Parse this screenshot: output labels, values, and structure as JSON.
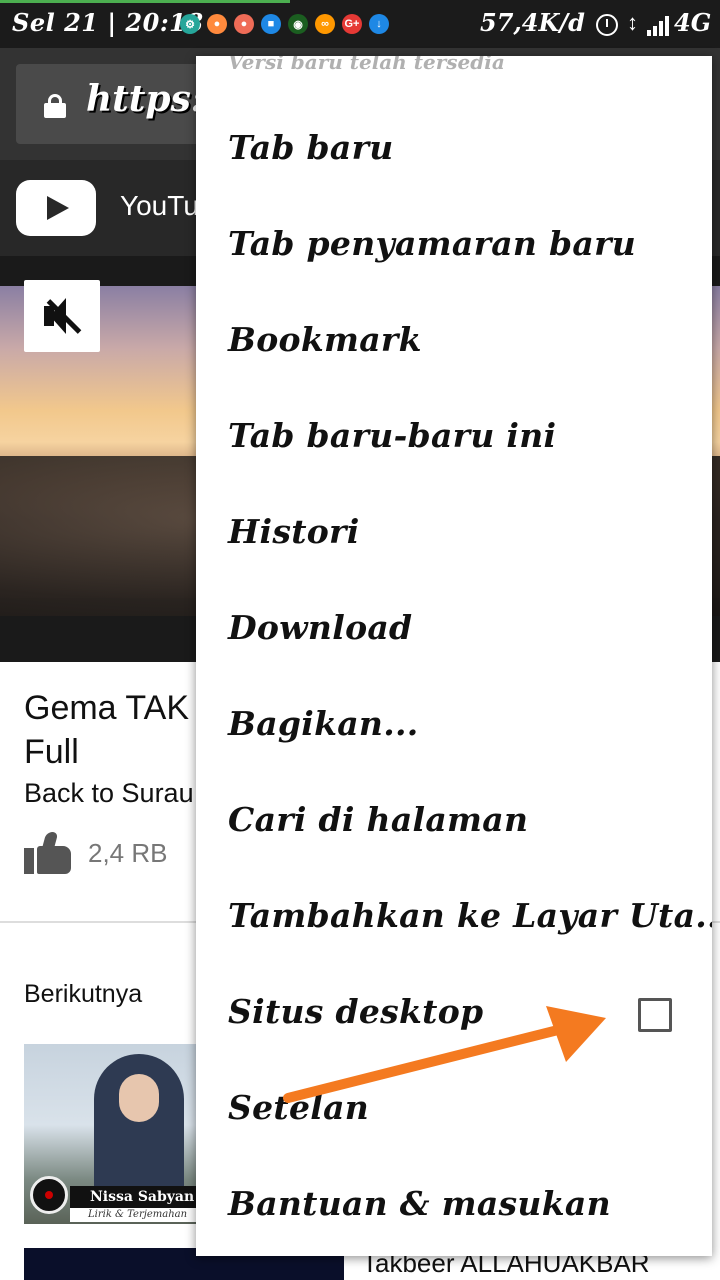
{
  "status_bar": {
    "time": "Sel 21 | 20:18",
    "speed": "57,4K/d",
    "arrows": "↕",
    "network": "4G",
    "notification_icons": [
      {
        "name": "settings-notif-icon",
        "color": "#26a69a",
        "glyph": "⚙"
      },
      {
        "name": "app-notif-icon-1",
        "color": "#ff8a3d",
        "glyph": "●"
      },
      {
        "name": "app-notif-icon-2",
        "color": "#ef6c57",
        "glyph": "●"
      },
      {
        "name": "app-notif-icon-3",
        "color": "#1e88e5",
        "glyph": "■"
      },
      {
        "name": "app-notif-icon-4",
        "color": "#1b5e20",
        "glyph": "◉"
      },
      {
        "name": "app-notif-icon-5",
        "color": "#ff9800",
        "glyph": "∞"
      },
      {
        "name": "google-plus-notif-icon",
        "color": "#e53935",
        "glyph": "G+"
      },
      {
        "name": "download-notif-icon",
        "color": "#1e88e5",
        "glyph": "↓"
      }
    ]
  },
  "browser": {
    "url": "https:/"
  },
  "youtube": {
    "header_title": "YouTu",
    "video_title": "Gema TAK Full",
    "channel": "Back to Surau",
    "like_count": "2,4 RB",
    "up_next_label": "Berikutnya",
    "thumb1_label_a": "Nissa Sabyan",
    "thumb1_label_b": "Lirik & Terjemahan",
    "next_title": "Takbeer ALLAHUAKBAR"
  },
  "menu": {
    "update_notice": "Versi baru telah tersedia",
    "items": [
      {
        "label": "Tab baru"
      },
      {
        "label": "Tab penyamaran baru"
      },
      {
        "label": "Bookmark"
      },
      {
        "label": "Tab baru-baru ini"
      },
      {
        "label": "Histori"
      },
      {
        "label": "Download"
      },
      {
        "label": "Bagikan..."
      },
      {
        "label": "Cari di halaman"
      },
      {
        "label": "Tambahkan ke Layar Uta..."
      },
      {
        "label": "Situs desktop",
        "checked": false
      },
      {
        "label": "Setelan"
      },
      {
        "label": "Bantuan & masukan"
      }
    ]
  },
  "annotation": {
    "arrow_color": "#f47a20"
  }
}
